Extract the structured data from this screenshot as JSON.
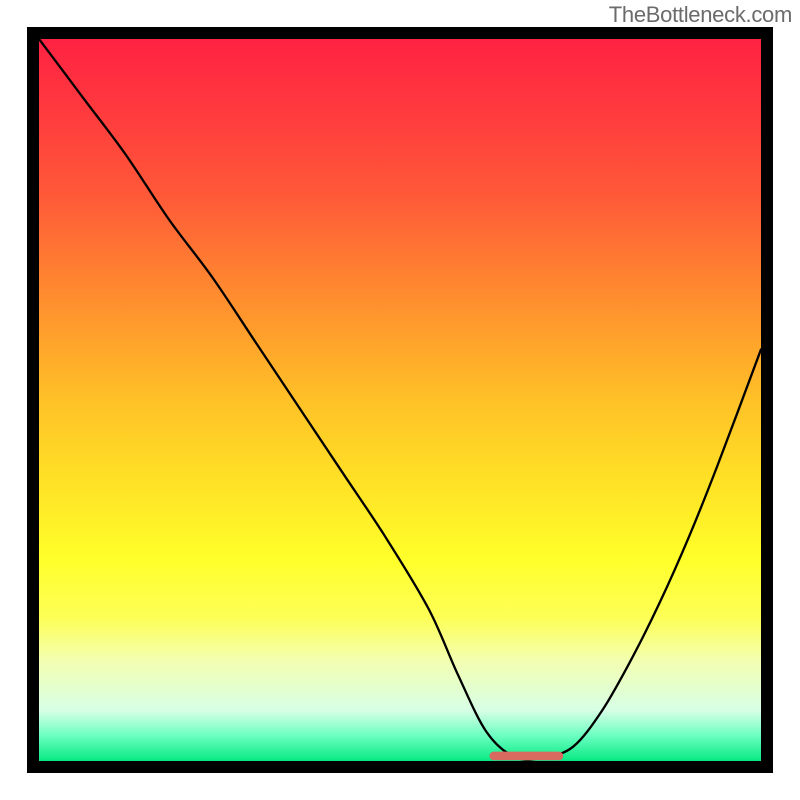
{
  "watermark": "TheBottleneck.com",
  "chart_data": {
    "type": "line",
    "title": "",
    "xlabel": "",
    "ylabel": "",
    "xlim": [
      0,
      100
    ],
    "ylim": [
      0,
      100
    ],
    "grid": false,
    "legend": false,
    "series": [
      {
        "name": "curve",
        "x": [
          0,
          6,
          12,
          18,
          24,
          30,
          36,
          42,
          48,
          54,
          58,
          62,
          66,
          70,
          74,
          78,
          82,
          86,
          90,
          94,
          100
        ],
        "values": [
          100,
          92,
          84,
          75,
          67,
          58,
          49,
          40,
          31,
          21,
          12,
          4,
          0.5,
          0.5,
          2,
          7,
          14,
          22,
          31,
          41,
          57
        ]
      }
    ],
    "flat_segment": {
      "x0": 63,
      "x1": 72,
      "y": 0.7,
      "color": "#d86a60"
    },
    "gradient_stops": [
      {
        "offset": 0.0,
        "color": "#ff2243"
      },
      {
        "offset": 0.1,
        "color": "#ff3a3e"
      },
      {
        "offset": 0.22,
        "color": "#ff5a38"
      },
      {
        "offset": 0.35,
        "color": "#ff8a2f"
      },
      {
        "offset": 0.5,
        "color": "#ffc127"
      },
      {
        "offset": 0.62,
        "color": "#ffe326"
      },
      {
        "offset": 0.72,
        "color": "#ffff2a"
      },
      {
        "offset": 0.8,
        "color": "#fdff55"
      },
      {
        "offset": 0.86,
        "color": "#f3ffb0"
      },
      {
        "offset": 0.93,
        "color": "#d7ffe6"
      },
      {
        "offset": 0.965,
        "color": "#6bffc1"
      },
      {
        "offset": 1.0,
        "color": "#07e981"
      }
    ]
  }
}
